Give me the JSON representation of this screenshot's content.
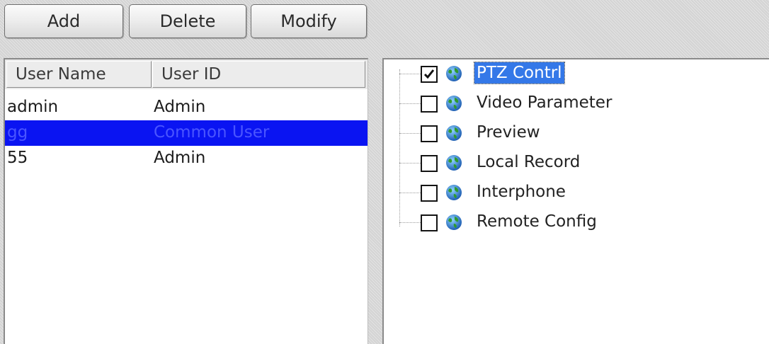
{
  "toolbar": {
    "add_label": "Add",
    "delete_label": "Delete",
    "modify_label": "Modify"
  },
  "user_list": {
    "columns": [
      "User Name",
      "User ID"
    ],
    "rows": [
      {
        "name": "admin",
        "id": "Admin",
        "selected": false
      },
      {
        "name": "gg",
        "id": "Common User",
        "selected": true
      },
      {
        "name": "55",
        "id": "Admin",
        "selected": false
      }
    ]
  },
  "permissions": {
    "items": [
      {
        "label": "PTZ Contrl",
        "checked": true,
        "selected": true
      },
      {
        "label": "Video Parameter",
        "checked": false,
        "selected": false
      },
      {
        "label": "Preview",
        "checked": false,
        "selected": false
      },
      {
        "label": "Local Record",
        "checked": false,
        "selected": false
      },
      {
        "label": "Interphone",
        "checked": false,
        "selected": false
      },
      {
        "label": "Remote Config",
        "checked": false,
        "selected": false
      }
    ]
  },
  "colors": {
    "selection_row": "#0a14f2",
    "selection_text": "#4a55ff",
    "tree_selection": "#3478e8"
  },
  "icons": {
    "permission_icon": "globe-icon",
    "check_icon": "checkmark-icon"
  }
}
